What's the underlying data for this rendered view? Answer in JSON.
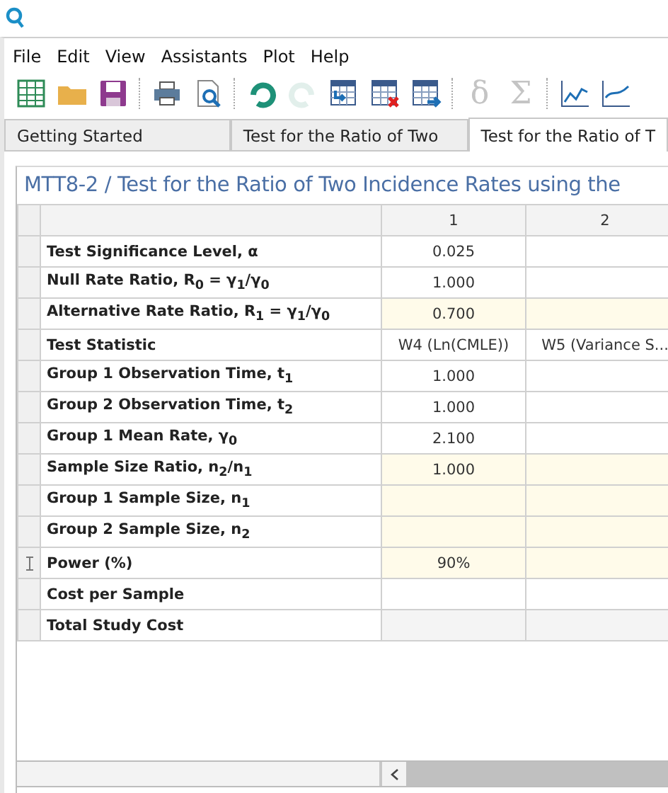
{
  "menu": [
    "File",
    "Edit",
    "View",
    "Assistants",
    "Plot",
    "Help"
  ],
  "toolbar": [
    {
      "kind": "spreadsheet",
      "disabled": false
    },
    {
      "kind": "folder",
      "disabled": false
    },
    {
      "kind": "save",
      "disabled": false
    },
    {
      "kind": "sep"
    },
    {
      "kind": "printer",
      "disabled": false
    },
    {
      "kind": "preview",
      "disabled": false
    },
    {
      "kind": "sep"
    },
    {
      "kind": "undo",
      "disabled": false
    },
    {
      "kind": "redo",
      "disabled": true
    },
    {
      "kind": "table-import",
      "disabled": false
    },
    {
      "kind": "table-delete",
      "disabled": false
    },
    {
      "kind": "table-export",
      "disabled": false
    },
    {
      "kind": "sep"
    },
    {
      "kind": "glyph",
      "text": "δ",
      "disabled": true
    },
    {
      "kind": "glyph",
      "text": "Σ",
      "disabled": true
    },
    {
      "kind": "sep"
    },
    {
      "kind": "line-chart",
      "disabled": false
    },
    {
      "kind": "area-chart",
      "disabled": false
    }
  ],
  "tabs": [
    {
      "label": "Getting Started",
      "selected": false
    },
    {
      "label": "Test for the Ratio of Two",
      "selected": false
    },
    {
      "label": "Test for the Ratio of T",
      "selected": true
    }
  ],
  "panel": {
    "title": "MTT8-2 / Test for the Ratio of Two Incidence Rates using the",
    "columns": [
      "1",
      "2"
    ],
    "rows": [
      {
        "label": "Test Significance Level, α",
        "value_1": "0.025",
        "kind": "plain",
        "editing": false
      },
      {
        "label": "Null Rate Ratio, R$_{0}$ = γ$_{1}$/γ$_{0}$",
        "value_1": "1.000",
        "kind": "plain",
        "editing": false
      },
      {
        "label": "Alternative Rate Ratio, R$_{1}$ = γ$_{1}$/γ$_{0}$",
        "value_1": "0.700",
        "kind": "input",
        "editing": false
      },
      {
        "label": "Test Statistic",
        "value_1": "W4 (Ln(CMLE))",
        "value_2": "W5 (Variance S...",
        "kind": "plain",
        "editing": false
      },
      {
        "label": "Group 1 Observation Time, t$_{1}$",
        "value_1": "1.000",
        "kind": "plain",
        "editing": false
      },
      {
        "label": "Group 2 Observation Time, t$_{2}$",
        "value_1": "1.000",
        "kind": "plain",
        "editing": false
      },
      {
        "label": "Group 1 Mean Rate, γ$_{0}$",
        "value_1": "2.100",
        "kind": "plain",
        "editing": false
      },
      {
        "label": "Sample Size Ratio, n$_{2}$/n$_{1}$",
        "value_1": "1.000",
        "kind": "input",
        "editing": false
      },
      {
        "label": "Group 1 Sample Size, n$_{1}$",
        "kind": "input",
        "editing": false
      },
      {
        "label": "Group 2 Sample Size, n$_{2}$",
        "kind": "input",
        "editing": false
      },
      {
        "label": "Power (%)",
        "value_1": "90%",
        "kind": "input",
        "editing": true
      },
      {
        "label": "Cost per Sample",
        "kind": "plain",
        "editing": false
      },
      {
        "label": "Total Study Cost",
        "kind": "total",
        "editing": false
      }
    ]
  }
}
